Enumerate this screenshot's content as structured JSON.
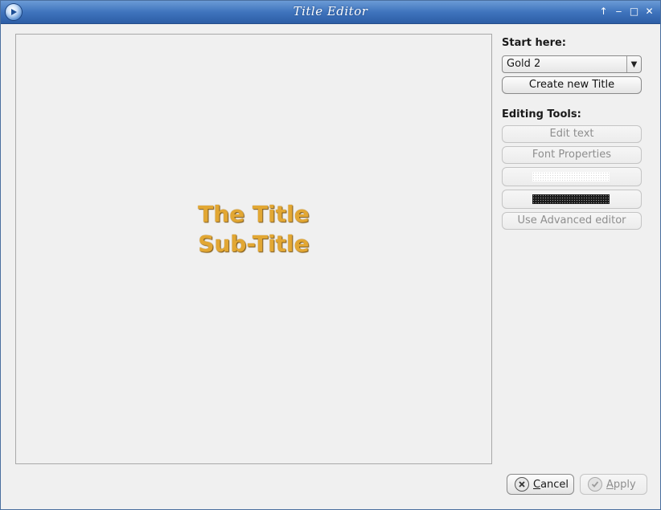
{
  "window": {
    "title": "Title Editor"
  },
  "titlebar": {
    "buttons": [
      {
        "name": "keep-above-icon",
        "glyph": "↑"
      },
      {
        "name": "minimize-icon",
        "glyph": "‒"
      },
      {
        "name": "maximize-icon",
        "glyph": "□"
      },
      {
        "name": "close-icon",
        "glyph": "✕"
      }
    ]
  },
  "preview": {
    "title_line": "The Title",
    "subtitle_line": "Sub-Title",
    "text_color": "#e2a733"
  },
  "side": {
    "start_label": "Start here:",
    "preset_value": "Gold 2",
    "create_button": "Create new Title",
    "tools_label": "Editing Tools:",
    "edit_text": "Edit text",
    "font_properties": "Font Properties",
    "advanced_editor": "Use Advanced editor"
  },
  "footer": {
    "cancel_mnemonic": "C",
    "cancel_rest": "ancel",
    "apply_mnemonic": "A",
    "apply_rest": "pply"
  }
}
